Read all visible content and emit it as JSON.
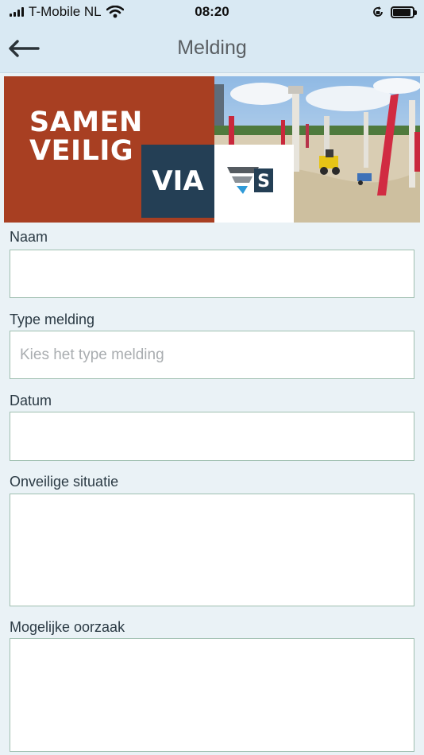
{
  "status_bar": {
    "carrier": "T-Mobile NL",
    "time": "08:20",
    "signal_bars": 4,
    "battery_level": 0.9
  },
  "nav": {
    "title": "Melding",
    "back_icon": "arrow-left-icon"
  },
  "banner": {
    "logo_line1": "SAMEN",
    "logo_line2": "VEILIG",
    "via_text": "VIA",
    "colors": {
      "red": "#a83f22",
      "navy": "#243f55"
    }
  },
  "form": {
    "name_label": "Naam",
    "name_value": "",
    "type_label": "Type melding",
    "type_placeholder": "Kies het type melding",
    "date_label": "Datum",
    "date_value": "",
    "unsafe_label": "Onveilige situatie",
    "unsafe_value": "",
    "cause_label": "Mogelijke oorzaak",
    "cause_value": ""
  }
}
